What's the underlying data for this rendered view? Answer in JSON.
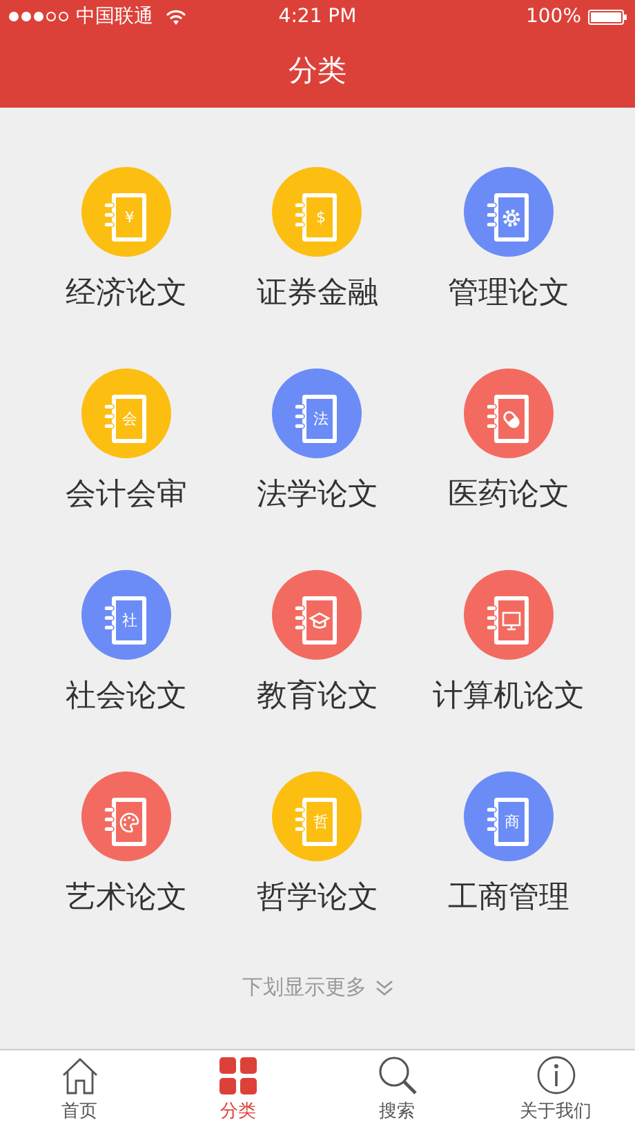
{
  "status_bar": {
    "carrier": "中国联通",
    "time": "4:21 PM",
    "battery": "100%"
  },
  "nav_bar": {
    "title": "分类"
  },
  "categories": [
    {
      "label": "经济论文",
      "color": "#fdbe12",
      "kind": "glyph",
      "glyph": "¥"
    },
    {
      "label": "证券金融",
      "color": "#fdbe12",
      "kind": "glyph",
      "glyph": "$"
    },
    {
      "label": "管理论文",
      "color": "#6b8cf6",
      "kind": "gear"
    },
    {
      "label": "会计会审",
      "color": "#fdbe12",
      "kind": "glyph",
      "glyph": "会"
    },
    {
      "label": "法学论文",
      "color": "#6b8cf6",
      "kind": "glyph",
      "glyph": "法"
    },
    {
      "label": "医药论文",
      "color": "#f36b60",
      "kind": "pill"
    },
    {
      "label": "社会论文",
      "color": "#6b8cf6",
      "kind": "glyph",
      "glyph": "社"
    },
    {
      "label": "教育论文",
      "color": "#f36b60",
      "kind": "cap"
    },
    {
      "label": "计算机论文",
      "color": "#f36b60",
      "kind": "monitor"
    },
    {
      "label": "艺术论文",
      "color": "#f36b60",
      "kind": "palette"
    },
    {
      "label": "哲学论文",
      "color": "#fdbe12",
      "kind": "glyph",
      "glyph": "哲"
    },
    {
      "label": "工商管理",
      "color": "#6b8cf6",
      "kind": "glyph",
      "glyph": "商"
    }
  ],
  "more_hint": "下划显示更多",
  "tab_bar": [
    {
      "label": "首页",
      "kind": "home",
      "selected": false
    },
    {
      "label": "分类",
      "kind": "grid",
      "selected": true
    },
    {
      "label": "搜索",
      "kind": "search",
      "selected": false
    },
    {
      "label": "关于我们",
      "kind": "info",
      "selected": false
    }
  ]
}
